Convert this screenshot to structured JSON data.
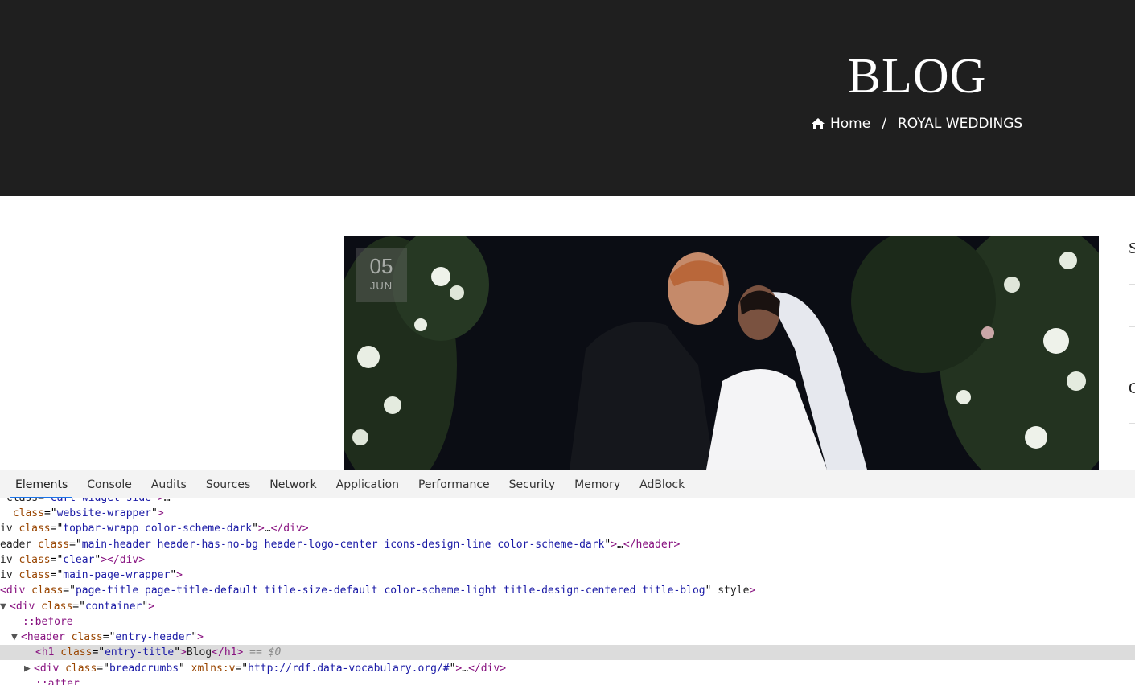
{
  "banner": {
    "title": "BLOG",
    "breadcrumbs": {
      "home": "Home",
      "separator": "/",
      "current": "ROYAL WEDDINGS"
    }
  },
  "post": {
    "date_day": "05",
    "date_month": "JUN"
  },
  "sidebar": {
    "heading1_initial": "S",
    "heading2_initial": "C"
  },
  "devtools": {
    "tabs": [
      "Elements",
      "Console",
      "Audits",
      "Sources",
      "Network",
      "Application",
      "Performance",
      "Security",
      "Memory",
      "AdBlock"
    ],
    "active_tab": "Elements",
    "lines": [
      {
        "pre": "class=\"cart-widget-side\">",
        "t": "…</div>"
      },
      {
        "pre": " class=\"website-wrapper\">"
      },
      {
        "pre": "iv class=\"topbar-wrapp color-scheme-dark\">…</div>"
      },
      {
        "pre": "eader class=\"main-header header-has-no-bg header-logo-center icons-design-line color-scheme-dark\">…</header>"
      },
      {
        "pre": "iv class=\"clear\"></div>"
      },
      {
        "pre": "iv class=\"main-page-wrapper\">"
      },
      {
        "pre": "<div class=\"page-title page-title-default title-size-default color-scheme-light title-design-centered title-blog\" style>"
      },
      {
        "pre": "<div class=\"container\">"
      },
      {
        "pre": "::before"
      },
      {
        "pre": "<header class=\"entry-header\">"
      },
      {
        "pre": "<h1 class=\"entry-title\">Blog</h1>",
        "suffix": "== $0"
      },
      {
        "pre": "<div class=\"breadcrumbs\" xmlns:v=\"http://rdf.data-vocabulary.org/#\">…</div>"
      },
      {
        "pre": "::after"
      }
    ]
  }
}
